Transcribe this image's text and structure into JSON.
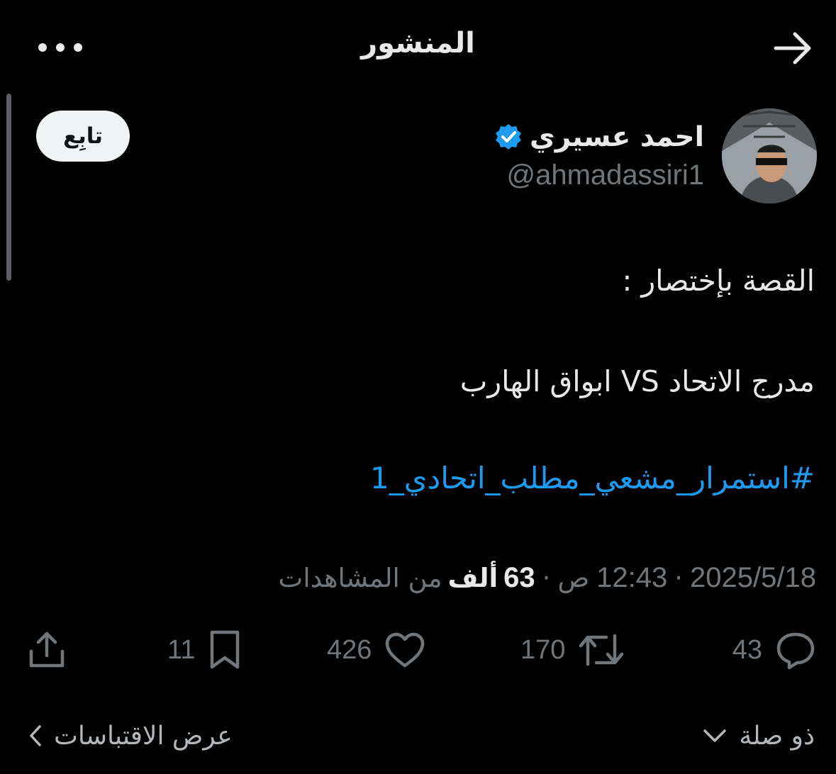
{
  "header": {
    "title": "المنشور",
    "back_icon": "arrow-right-icon",
    "more_icon": "more-dots-icon"
  },
  "author": {
    "name": "احمد عسيري",
    "handle": "@ahmadassiri1",
    "verified": true,
    "follow_label": "تابِع"
  },
  "post": {
    "line1": "القصة بإختصار :",
    "line2": "مدرج الاتحاد VS ابواق الهارب",
    "hashtag": "#استمرار_مشعي_مطلب_اتحادي_1"
  },
  "meta": {
    "date": "2025/5/18",
    "time": "12:43",
    "ampm": "ص",
    "views_number": "63",
    "views_unit": "ألف",
    "views_label": "من المشاهدات"
  },
  "actions": {
    "replies": "43",
    "reposts": "170",
    "likes": "426",
    "bookmarks": "11"
  },
  "bottom": {
    "relevance": "ذو صلة",
    "quotes": "عرض الاقتباسات"
  },
  "colors": {
    "background": "#000000",
    "text": "#e7e9ea",
    "muted": "#71767b",
    "accent": "#1d9bf0"
  }
}
